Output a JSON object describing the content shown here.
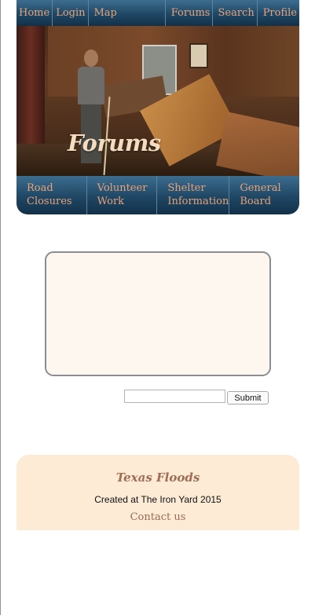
{
  "nav": {
    "home": "Home",
    "login": "Login",
    "map": "Map",
    "forums": "Forums",
    "search": "Search",
    "profile": "Profile"
  },
  "hero": {
    "title": "Forums"
  },
  "categories": [
    {
      "line1": "Road",
      "line2": "Closures"
    },
    {
      "line1": "Volunteer",
      "line2": "Work"
    },
    {
      "line1": "Shelter",
      "line2": "Information"
    },
    {
      "line1": "General",
      "line2": "Board"
    }
  ],
  "form": {
    "input_value": "",
    "submit_label": "Submit"
  },
  "footer": {
    "brand": "Texas Floods",
    "credit": "Created at The Iron Yard 2015",
    "contact": "Contact us"
  },
  "colors": {
    "nav_gradient_top": "#3d6d8e",
    "nav_gradient_bottom": "#123149",
    "nav_text": "#e6a37a",
    "footer_bg": "#fdebd6",
    "message_box_bg": "#fdf7f0"
  }
}
